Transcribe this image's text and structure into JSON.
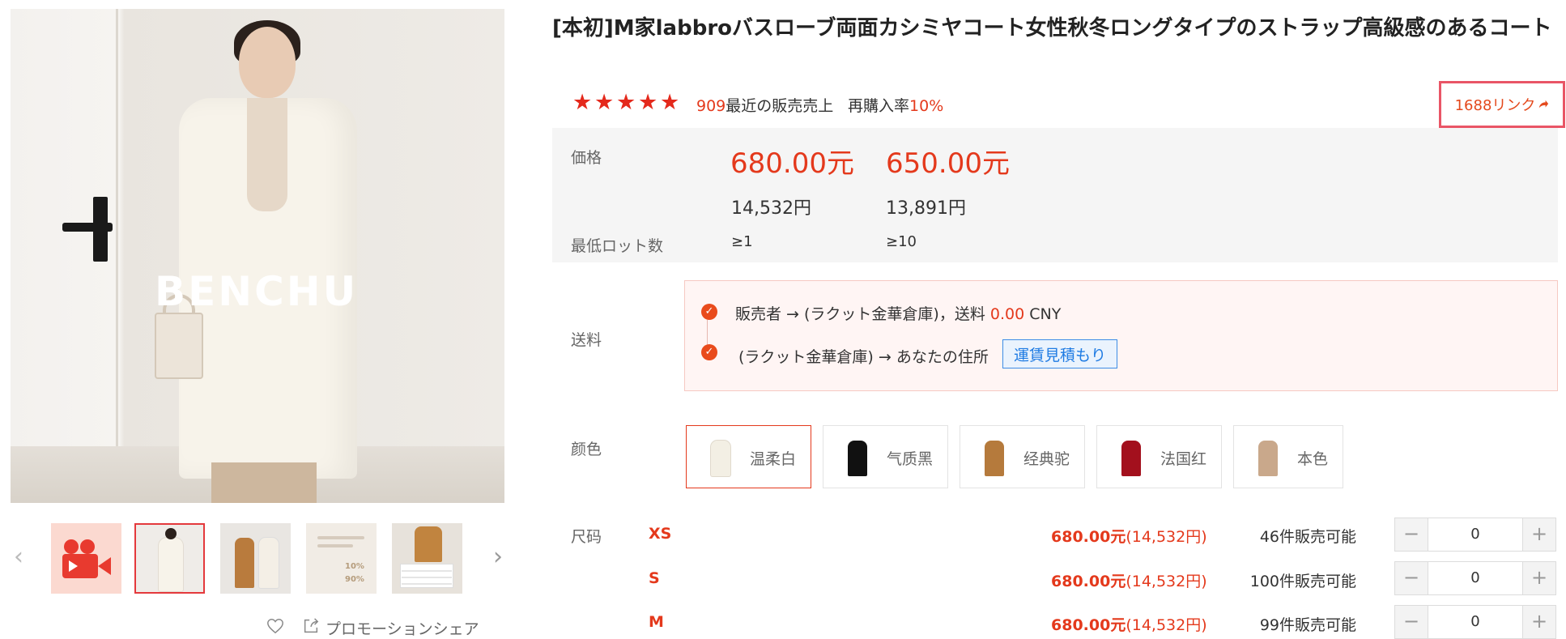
{
  "gallery": {
    "brand_watermark": "BENCHU",
    "prev_arrow": "‹",
    "next_arrow": "›",
    "thumbnails": [
      {
        "kind": "video"
      },
      {
        "kind": "image",
        "selected": true
      },
      {
        "kind": "image"
      },
      {
        "kind": "image",
        "text_1": "10%",
        "text_2": "90%"
      },
      {
        "kind": "image"
      }
    ],
    "favorite_icon": "heart-outline-icon",
    "share_icon": "share-icon",
    "share_label": "プロモーションシェア"
  },
  "product": {
    "title": "[本初]M家labbroバスローブ両面カシミヤコート女性秋冬ロングタイプのストラップ高級感のあるコート",
    "rating_stars": 5,
    "sales_count": "909",
    "sales_label": "最近の販売売上",
    "rebuy_label": "再購入率",
    "rebuy_rate": "10%",
    "link_label": "1688リンク",
    "link_icon": "share-arrow-icon"
  },
  "pricing": {
    "price_label": "価格",
    "lot_label": "最低ロット数",
    "tiers": [
      {
        "price": "680.00元",
        "yen": "14,532円",
        "min_lot": "≥1"
      },
      {
        "price": "650.00元",
        "yen": "13,891円",
        "min_lot": "≥10"
      }
    ]
  },
  "shipping": {
    "label": "送料",
    "route_1": "販売者 → (ラクット金華倉庫)，送料",
    "route_1_fee": "0.00",
    "route_1_currency": "CNY",
    "route_2": "(ラクット金華倉庫) → あなたの住所",
    "quote_button": "運賃見積もり",
    "check_icon": "check-circle-icon"
  },
  "colors": {
    "label": "颜色",
    "options": [
      {
        "name": "温柔白",
        "swatch": "#f3efe4",
        "selected": true
      },
      {
        "name": "气质黑",
        "swatch": "#111111"
      },
      {
        "name": "经典驼",
        "swatch": "#b57a3c"
      },
      {
        "name": "法国红",
        "swatch": "#a3101d"
      },
      {
        "name": "本色",
        "swatch": "#c9a88b"
      }
    ]
  },
  "sizes": {
    "label": "尺码",
    "rows": [
      {
        "code": "XS",
        "price": "680.00元",
        "yen": "(14,532円)",
        "available": "46件販売可能",
        "qty": "0"
      },
      {
        "code": "S",
        "price": "680.00元",
        "yen": "(14,532円)",
        "available": "100件販売可能",
        "qty": "0"
      },
      {
        "code": "M",
        "price": "680.00元",
        "yen": "(14,532円)",
        "available": "99件販売可能",
        "qty": "0"
      }
    ],
    "minus": "−",
    "plus": "+"
  },
  "colors_theme": {
    "accent_red": "#e4391c",
    "link_border": "#e95566",
    "quote_blue": "#1e7be3"
  }
}
